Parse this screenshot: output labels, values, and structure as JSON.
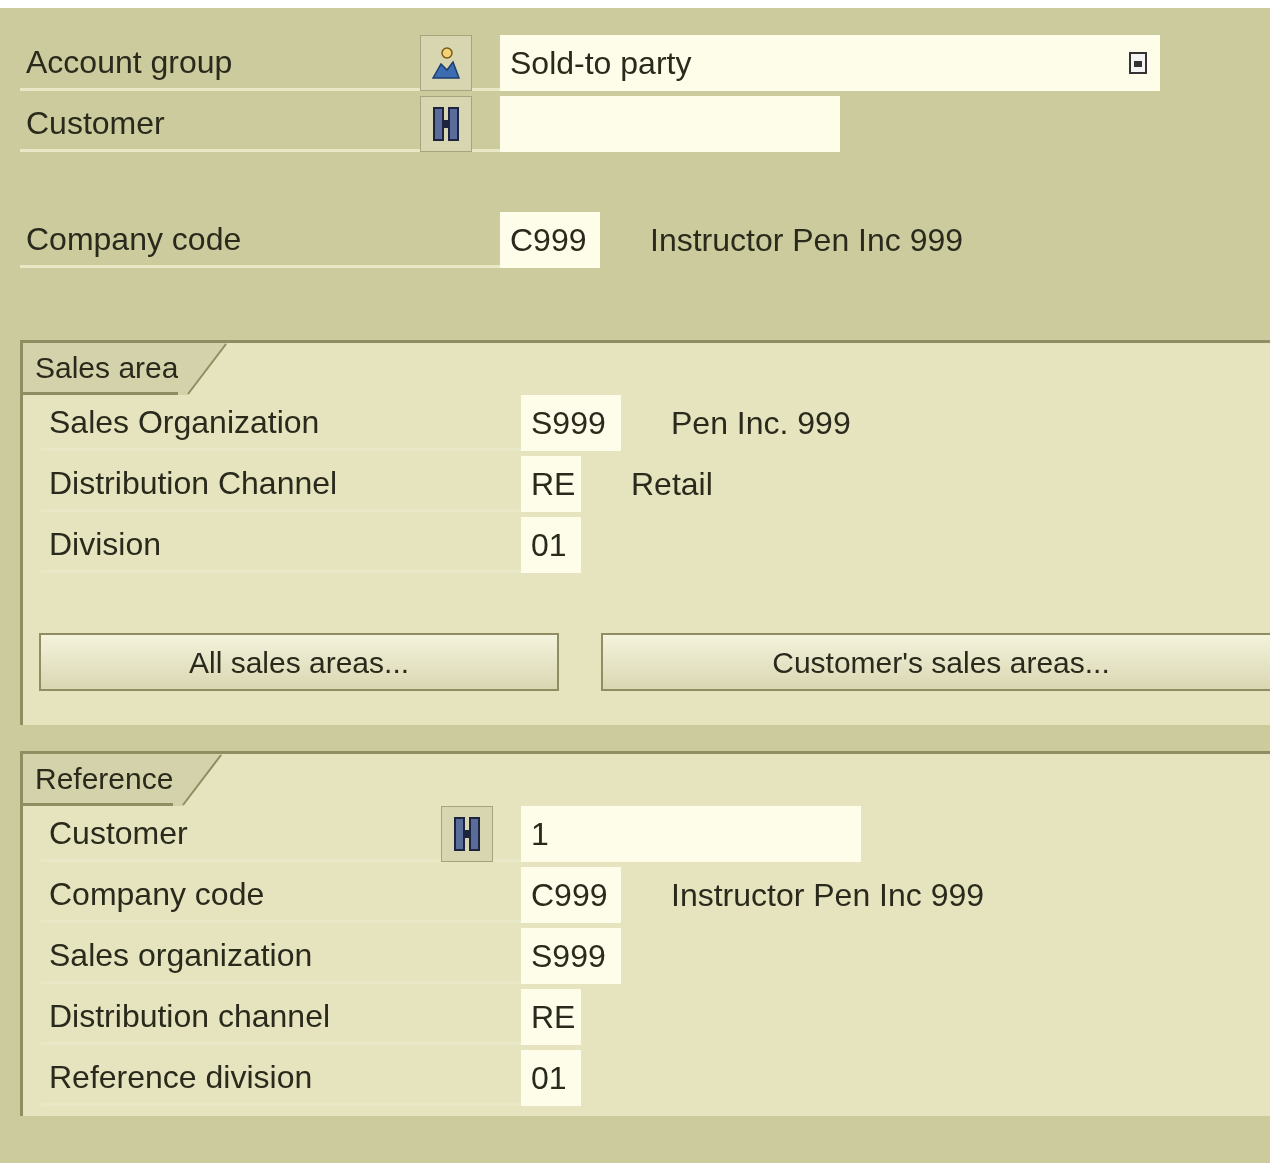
{
  "header_fields": [
    {
      "label": "Account group",
      "kind": "select",
      "value": "Sold-to party"
    },
    {
      "label": "Customer",
      "kind": "search"
    }
  ],
  "company": {
    "label": "Company code",
    "value": "C999",
    "description": "Instructor Pen Inc 999"
  },
  "sales_area": {
    "title": "Sales area",
    "fields": [
      {
        "label": "Sales Organization",
        "value": "S999",
        "description": "Pen Inc. 999"
      },
      {
        "label": "Distribution Channel",
        "value": "RE",
        "description": "Retail"
      },
      {
        "label": "Division",
        "value": "01"
      }
    ],
    "buttons": [
      "All sales areas...",
      "Customer's sales areas..."
    ]
  },
  "reference": {
    "title": "Reference",
    "fields": [
      {
        "label": "Customer",
        "kind": "search",
        "value": "1"
      },
      {
        "label": "Company code",
        "value": "C999",
        "description": "Instructor Pen Inc 999"
      },
      {
        "label": "Sales organization",
        "value": "S999"
      },
      {
        "label": "Distribution channel",
        "value": "RE"
      },
      {
        "label": "Reference division",
        "value": "01"
      }
    ]
  }
}
